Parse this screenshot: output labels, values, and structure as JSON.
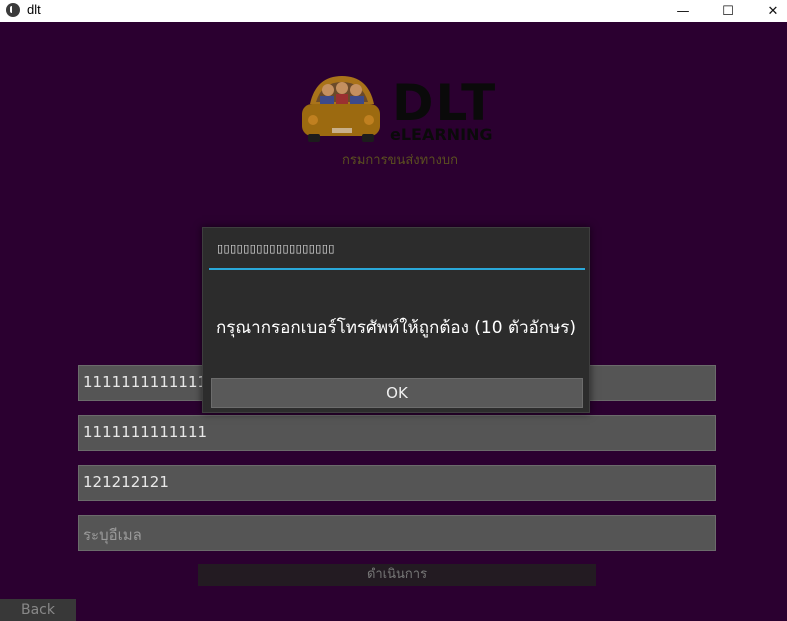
{
  "window": {
    "title": "dlt",
    "minimize_symbol": "—",
    "maximize_symbol": "☐",
    "close_symbol": "✕"
  },
  "logo": {
    "brand": "DLT",
    "brand_sub": "eLEARNING",
    "subtitle": "กรมการขนส่งทางบก"
  },
  "form": {
    "fields": [
      {
        "value": "1111111111111",
        "placeholder": ""
      },
      {
        "value": "1111111111111",
        "placeholder": ""
      },
      {
        "value": "121212121",
        "placeholder": ""
      },
      {
        "value": "",
        "placeholder": "ระบุอีเมล"
      }
    ],
    "submit_label": "ดำเนินการ",
    "back_label": "Back"
  },
  "dialog": {
    "title": "▯▯▯▯▯▯▯▯▯▯▯▯▯▯▯▯▯▯",
    "message": "กรุณากรอกเบอร์โทรศัพท์ให้ถูกต้อง (10 ตัวอักษร)",
    "ok_label": "OK",
    "accent": "#2aa8d9"
  },
  "colors": {
    "background": "#2b0030",
    "field_bg": "#555555"
  }
}
